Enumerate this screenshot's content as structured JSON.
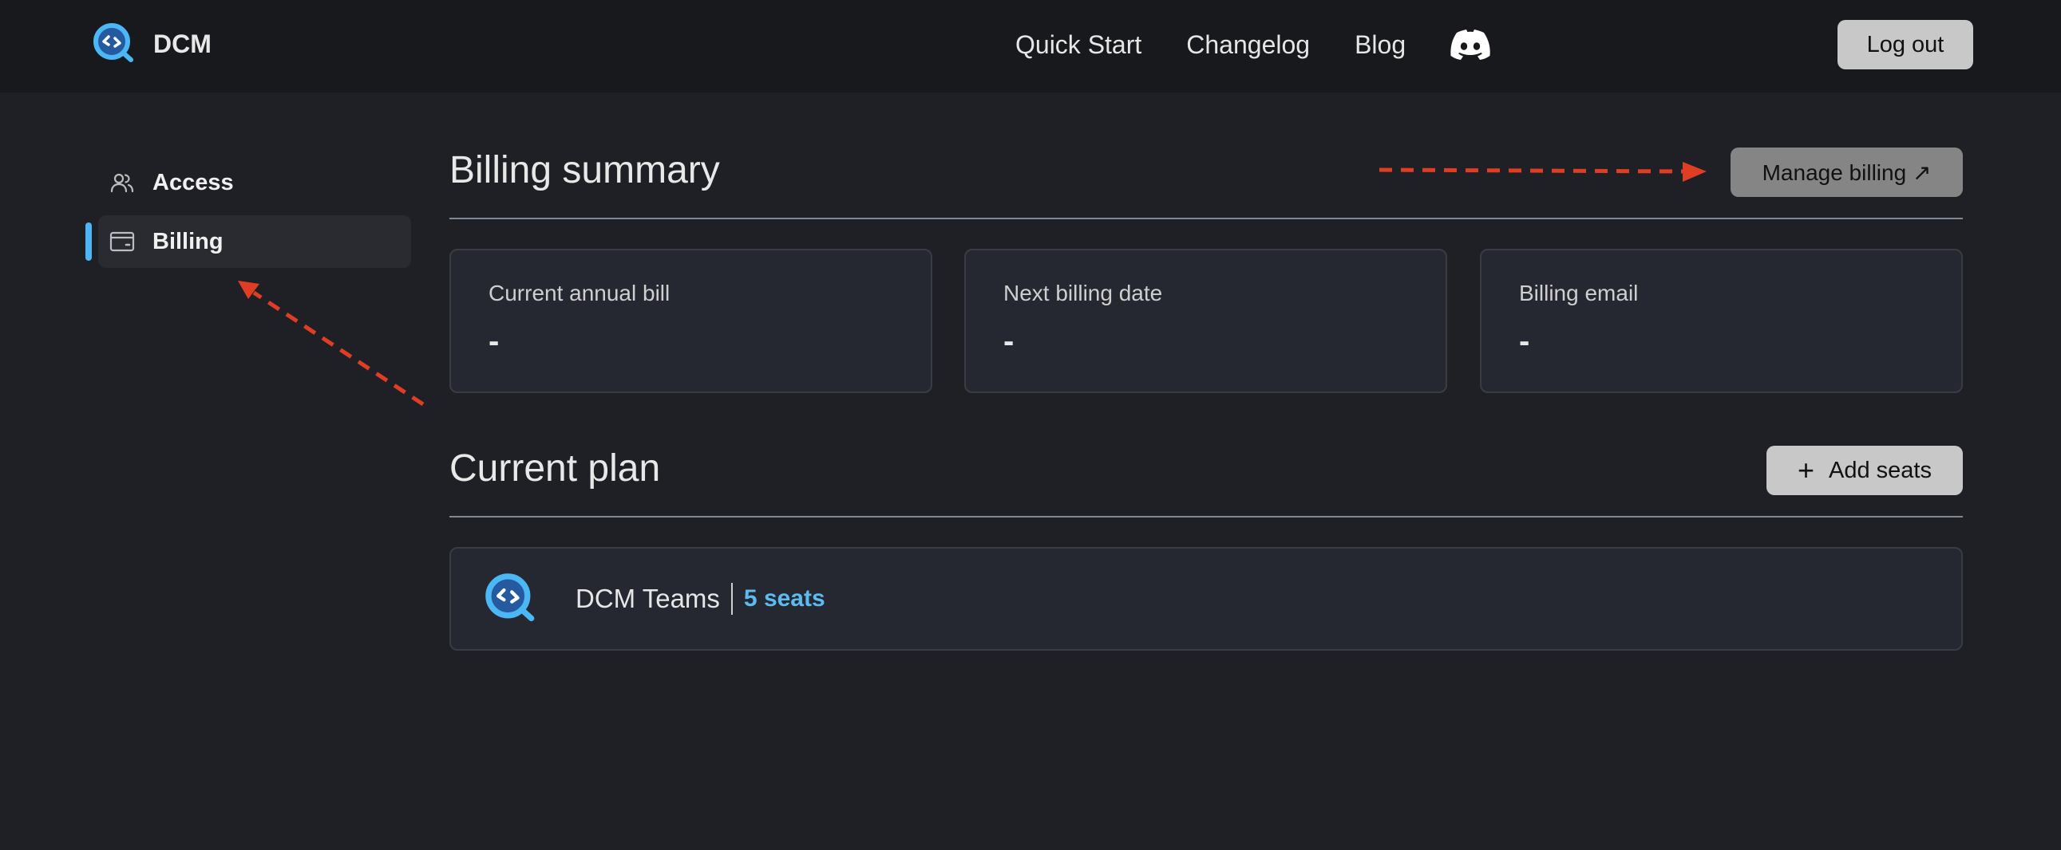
{
  "header": {
    "brand_name": "DCM",
    "nav": [
      {
        "label": "Quick Start"
      },
      {
        "label": "Changelog"
      },
      {
        "label": "Blog"
      }
    ],
    "discord_icon": "discord-icon",
    "logout_label": "Log out"
  },
  "sidebar": {
    "items": [
      {
        "label": "Access",
        "icon": "users-icon",
        "active": false
      },
      {
        "label": "Billing",
        "icon": "credit-card-icon",
        "active": true
      }
    ]
  },
  "billing_summary": {
    "title": "Billing summary",
    "manage_label": "Manage billing ↗",
    "cards": [
      {
        "label": "Current annual bill",
        "value": "-"
      },
      {
        "label": "Next billing date",
        "value": "-"
      },
      {
        "label": "Billing email",
        "value": "-"
      }
    ]
  },
  "current_plan": {
    "title": "Current plan",
    "add_seats_label": "Add seats",
    "plan_name": "DCM Teams",
    "seats": "5 seats"
  },
  "colors": {
    "accent": "#4bb8f5",
    "annotation": "#e03e24",
    "background": "#1f2026",
    "header_bg": "#18191d"
  }
}
